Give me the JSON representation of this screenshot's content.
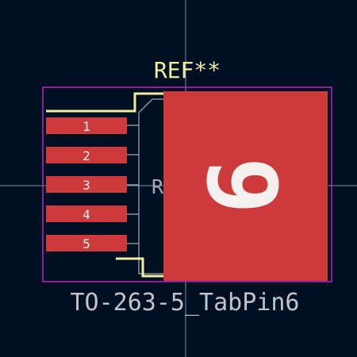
{
  "footprint": {
    "reference": "REF**",
    "value": "TO-263-5_TabPin6",
    "fab_reference": "R"
  },
  "pads": [
    {
      "number": "1"
    },
    {
      "number": "2"
    },
    {
      "number": "3"
    },
    {
      "number": "4"
    },
    {
      "number": "5"
    },
    {
      "number": "6"
    }
  ],
  "colors": {
    "background": "#001023",
    "crosshair": "#7f8fa3",
    "courtyard": "#c020c0",
    "silkscreen": "#f2eda1",
    "fab_outline": "#a8a8b0",
    "pad_fill": "#cd3a3c",
    "pad_label": "#f4f0f0",
    "value_text": "#c2c2c8"
  }
}
